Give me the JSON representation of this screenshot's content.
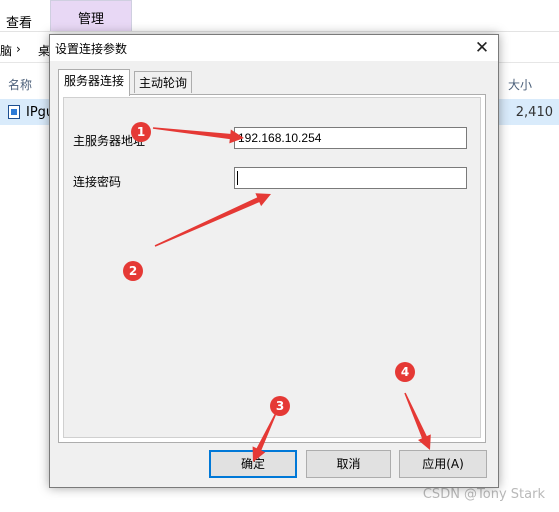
{
  "explorer": {
    "tabs": {
      "view": "查看",
      "manage": "管理"
    },
    "breadcrumb": {
      "part1": "脑",
      "sep": "›",
      "part2": "桌"
    },
    "columns": {
      "name": "名称",
      "size": "大小"
    },
    "file": {
      "name": "IPgu",
      "size": "2,410"
    }
  },
  "dialog": {
    "title": "设置连接参数",
    "close_glyph": "✕",
    "tabs": [
      "服务器连接",
      "主动轮询"
    ],
    "address_label": "主服务器地址",
    "address_value": "192.168.10.254",
    "password_label": "连接密码",
    "password_value": "",
    "buttons": {
      "ok": "确定",
      "cancel": "取消",
      "apply": "应用(A)"
    }
  },
  "annotations": {
    "color": "#e53935",
    "badges": [
      "1",
      "2",
      "3",
      "4"
    ]
  },
  "watermark": "CSDN @Tony Stark"
}
